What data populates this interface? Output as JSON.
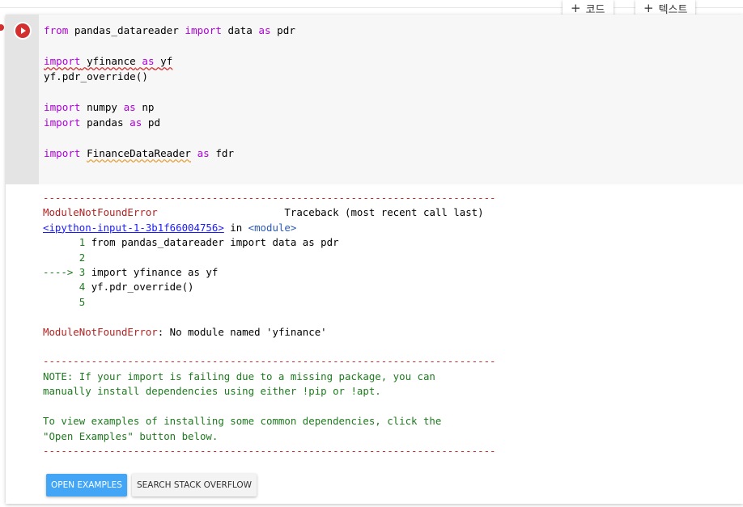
{
  "toolbar": {
    "add_code_label": "코드",
    "add_text_label": "텍스트"
  },
  "code": {
    "lines": [
      [
        "from",
        " pandas_datareader ",
        "import",
        " data ",
        "as",
        " pdr"
      ],
      [
        "import",
        " ",
        "yfinance",
        " as ",
        "yf"
      ],
      [
        "yf.pdr_override()"
      ],
      [
        "import",
        " numpy ",
        "as",
        " np"
      ],
      [
        "import",
        " pandas ",
        "as",
        " pd"
      ],
      [
        "import",
        " ",
        "FinanceDataReader",
        " ",
        "as",
        " fdr"
      ]
    ],
    "l1_kw1": "from",
    "l1_mod": " pandas_datareader ",
    "l1_kw2": "import",
    "l1_name": " data ",
    "l1_kw3": "as",
    "l1_alias": " pdr",
    "l2_kw1": "import",
    "l2_mod": "yfinance",
    "l2_kw2": "as",
    "l2_alias": "yf",
    "l3": "yf.pdr_override()",
    "l4_kw1": "import",
    "l4_mod": " numpy ",
    "l4_kw2": "as",
    "l4_alias": " np",
    "l5_kw1": "import",
    "l5_mod": " pandas ",
    "l5_kw2": "as",
    "l5_alias": " pd",
    "l6_kw1": "import",
    "l6_mod": "FinanceDataReader",
    "l6_kw2": "as",
    "l6_alias": " fdr"
  },
  "output": {
    "rule": "---------------------------------------------------------------------------",
    "error_name": "ModuleNotFoundError",
    "traceback_label": "Traceback (most recent call last)",
    "input_link": "<ipython-input-1-3b1f66004756>",
    "in_text": " in ",
    "module_tag": "<module>",
    "tb_l1_num": "      1 ",
    "tb_l1_code": "from pandas_datareader import data as pdr",
    "tb_l2_num": "      2",
    "tb_arrow": "----> 3 ",
    "tb_l3_code": "import yfinance as yf",
    "tb_l4_num": "      4 ",
    "tb_l4_code": "yf.pdr_override()",
    "tb_l5_num": "      5",
    "error_message_name": "ModuleNotFoundError",
    "error_message": ": No module named 'yfinance'",
    "note_line1": "NOTE: If your import is failing due to a missing package, you can",
    "note_line2": "manually install dependencies using either !pip or !apt.",
    "note_line3": "To view examples of installing some common dependencies, click the",
    "note_line4": "\"Open Examples\" button below."
  },
  "buttons": {
    "open_examples": "OPEN EXAMPLES",
    "search_stack_overflow": "SEARCH STACK OVERFLOW"
  },
  "colors": {
    "run_button": "#d32f2f",
    "keyword": "#af00db",
    "primary_button": "#42a5f5",
    "note_text": "#1e7a1e"
  },
  "icons": {
    "run": "play-circle-icon",
    "add": "plus-icon"
  }
}
